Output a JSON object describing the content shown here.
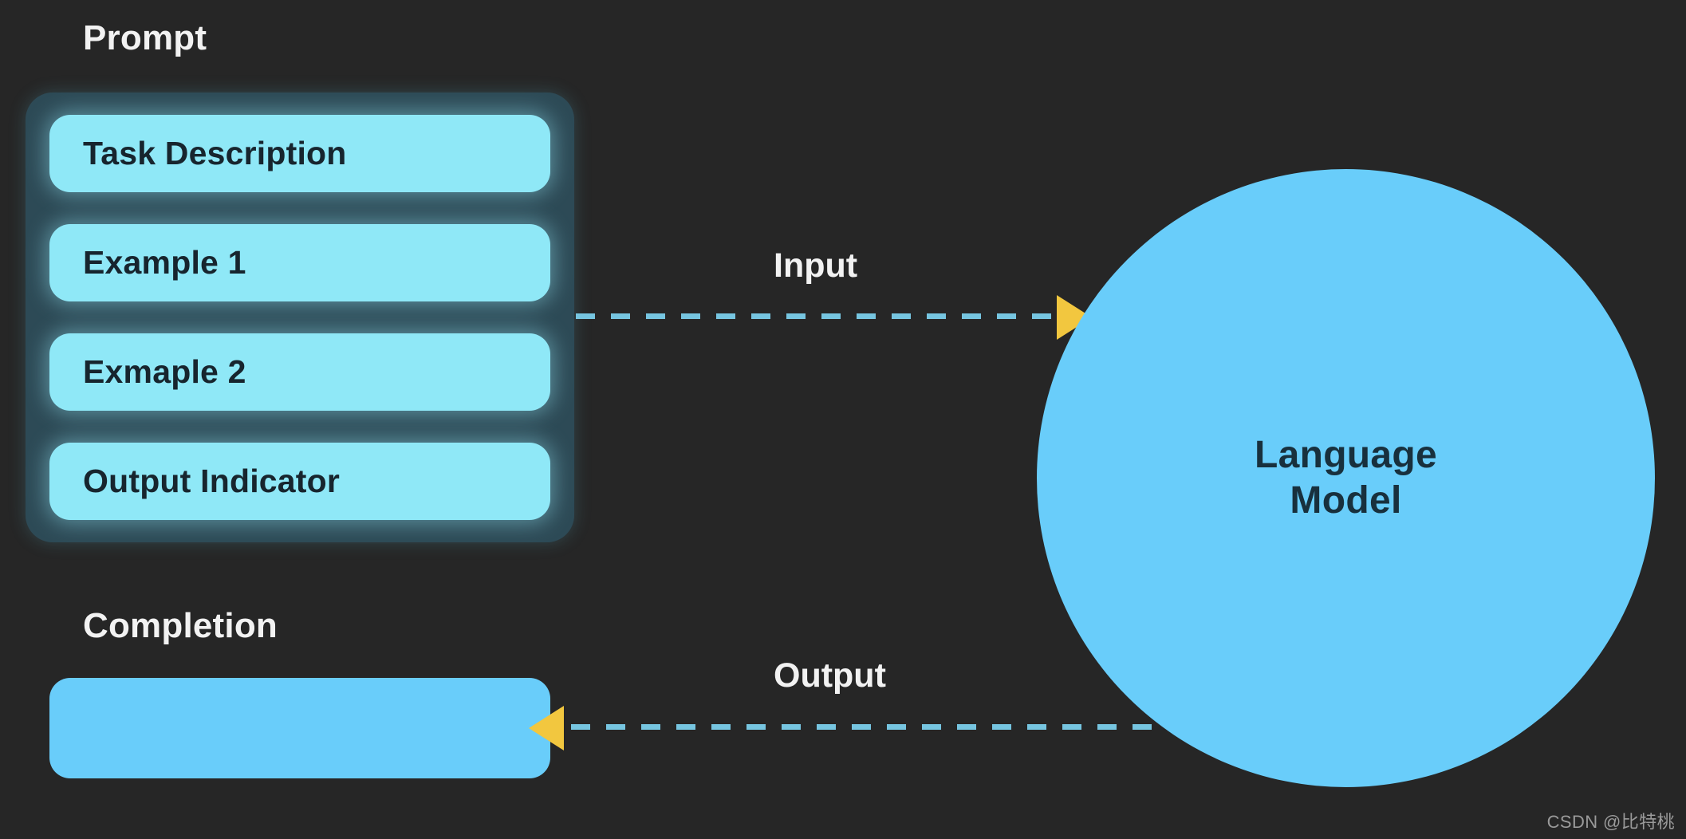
{
  "background_color": "#262626",
  "palette": {
    "prompt_box_fill": "#8fe8f7",
    "prompt_container_fill": "#2d4a56",
    "model_circle_fill": "#69cdfa",
    "completion_box_fill": "#69cdfa",
    "arrow_color": "#f2c73f",
    "dash_line_color": "#76c5e0",
    "heading_text_color": "#f2f2f2",
    "box_text_color": "#17252e"
  },
  "prompt": {
    "heading": "Prompt",
    "boxes": [
      {
        "label": "Task Description"
      },
      {
        "label": "Example 1"
      },
      {
        "label": "Exmaple 2"
      },
      {
        "label": "Output Indicator"
      }
    ]
  },
  "completion": {
    "heading": "Completion",
    "box": {
      "label": ""
    }
  },
  "model": {
    "line1": "Language",
    "line2": "Model"
  },
  "connectors": {
    "input": {
      "label": "Input",
      "direction": "right",
      "style": "dashed"
    },
    "output": {
      "label": "Output",
      "direction": "left",
      "style": "dashed"
    }
  },
  "watermark": {
    "text": "CSDN @比特桃"
  }
}
